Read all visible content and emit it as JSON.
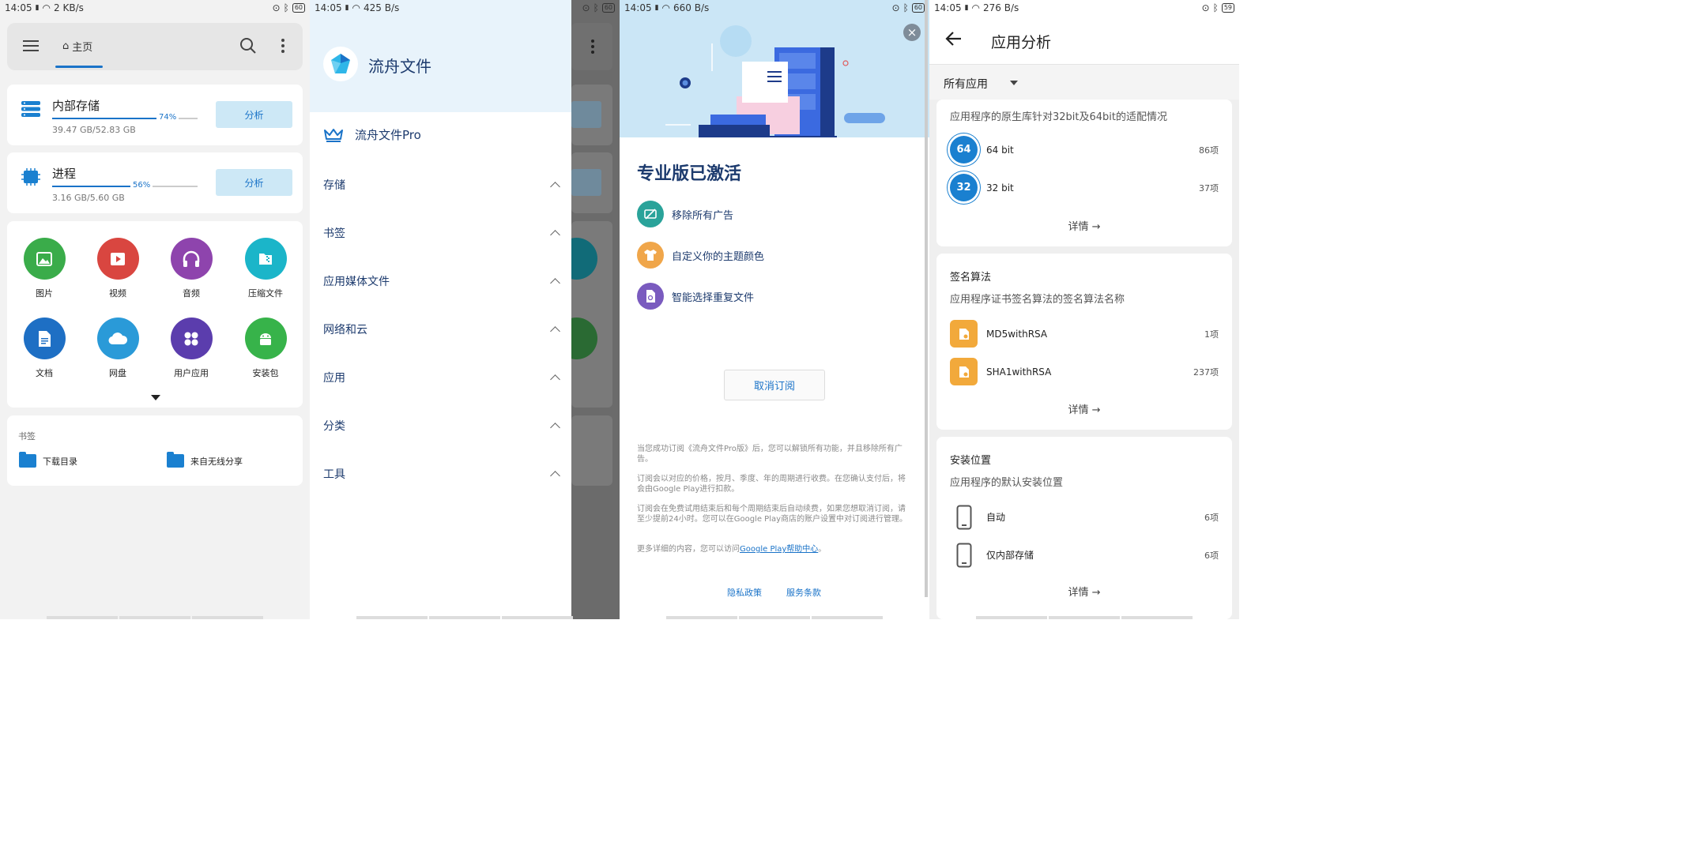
{
  "screens": [
    {
      "status": {
        "time": "14:05",
        "speed": "2 KB/s",
        "battery": "60"
      }
    },
    {
      "status": {
        "time": "14:05",
        "speed": "425 B/s",
        "battery": "60"
      }
    },
    {
      "status": {
        "time": "14:05",
        "speed": "660 B/s",
        "battery": "60"
      }
    },
    {
      "status": {
        "time": "14:05",
        "speed": "276 B/s",
        "battery": "59"
      }
    }
  ],
  "home": {
    "tab_label": "主页",
    "internal": {
      "title": "内部存储",
      "percent": "74%",
      "fill": 0.74,
      "detail": "39.47 GB/52.83 GB",
      "button": "分析"
    },
    "process": {
      "title": "进程",
      "percent": "56%",
      "fill": 0.56,
      "detail": "3.16 GB/5.60 GB",
      "button": "分析"
    },
    "categories": [
      {
        "label": "图片",
        "color": "#3aac4a",
        "icon": "image-icon"
      },
      {
        "label": "视频",
        "color": "#d94640",
        "icon": "video-icon"
      },
      {
        "label": "音频",
        "color": "#8e44ad",
        "icon": "headphones-icon"
      },
      {
        "label": "压缩文件",
        "color": "#1bb5c9",
        "icon": "archive-icon"
      },
      {
        "label": "文档",
        "color": "#1e6fc4",
        "icon": "document-icon"
      },
      {
        "label": "网盘",
        "color": "#2a9ad8",
        "icon": "cloud-icon"
      },
      {
        "label": "用户应用",
        "color": "#5b3dad",
        "icon": "apps-icon"
      },
      {
        "label": "安装包",
        "color": "#37b34a",
        "icon": "android-icon"
      }
    ],
    "bookmarks": {
      "title": "书签",
      "items": [
        "下载目录",
        "来自无线分享"
      ]
    }
  },
  "drawer": {
    "app_name": "流舟文件",
    "pro_label": "流舟文件Pro",
    "sections": [
      "存储",
      "书签",
      "应用媒体文件",
      "网络和云",
      "应用",
      "分类",
      "工具"
    ]
  },
  "pro": {
    "title": "专业版已激活",
    "features": [
      {
        "label": "移除所有广告",
        "color": "#2aa39a",
        "icon": "no-ads-icon"
      },
      {
        "label": "自定义你的主题颜色",
        "color": "#f0a64a",
        "icon": "shirt-icon"
      },
      {
        "label": "智能选择重复文件",
        "color": "#7a5bbf",
        "icon": "duplicate-file-icon"
      }
    ],
    "cancel_button": "取消订阅",
    "notice1": "当您成功订阅《流舟文件Pro版》后，您可以解锁所有功能，并且移除所有广告。",
    "notice2": "订阅会以对应的价格，按月、季度、年的周期进行收费。在您确认支付后，将会由Google Play进行扣款。",
    "notice3": "订阅会在免费试用结束后和每个周期结束后自动续费，如果您想取消订阅，请至少提前24小时。您可以在Google Play商店的账户设置中对订阅进行管理。",
    "notice4_prefix": "更多详细的内容，您可以访问",
    "notice4_link": "Google Play帮助中心",
    "notice4_suffix": "。",
    "privacy": "隐私政策",
    "terms": "服务条款"
  },
  "analysis": {
    "title": "应用分析",
    "filter": "所有应用",
    "native": {
      "subtitle": "应用程序的原生库针对32bit及64bit的适配情况",
      "rows": [
        {
          "chip": "64",
          "label": "64 bit",
          "count": "86项"
        },
        {
          "chip": "32",
          "label": "32 bit",
          "count": "37项"
        }
      ],
      "details": "详情"
    },
    "signature": {
      "title": "签名算法",
      "subtitle": "应用程序证书签名算法的签名算法名称",
      "rows": [
        {
          "label": "MD5withRSA",
          "count": "1项"
        },
        {
          "label": "SHA1withRSA",
          "count": "237项"
        }
      ],
      "details": "详情"
    },
    "install": {
      "title": "安装位置",
      "subtitle": "应用程序的默认安装位置",
      "rows": [
        {
          "label": "自动",
          "count": "6项"
        },
        {
          "label": "仅内部存储",
          "count": "6项"
        }
      ],
      "details": "详情"
    }
  }
}
